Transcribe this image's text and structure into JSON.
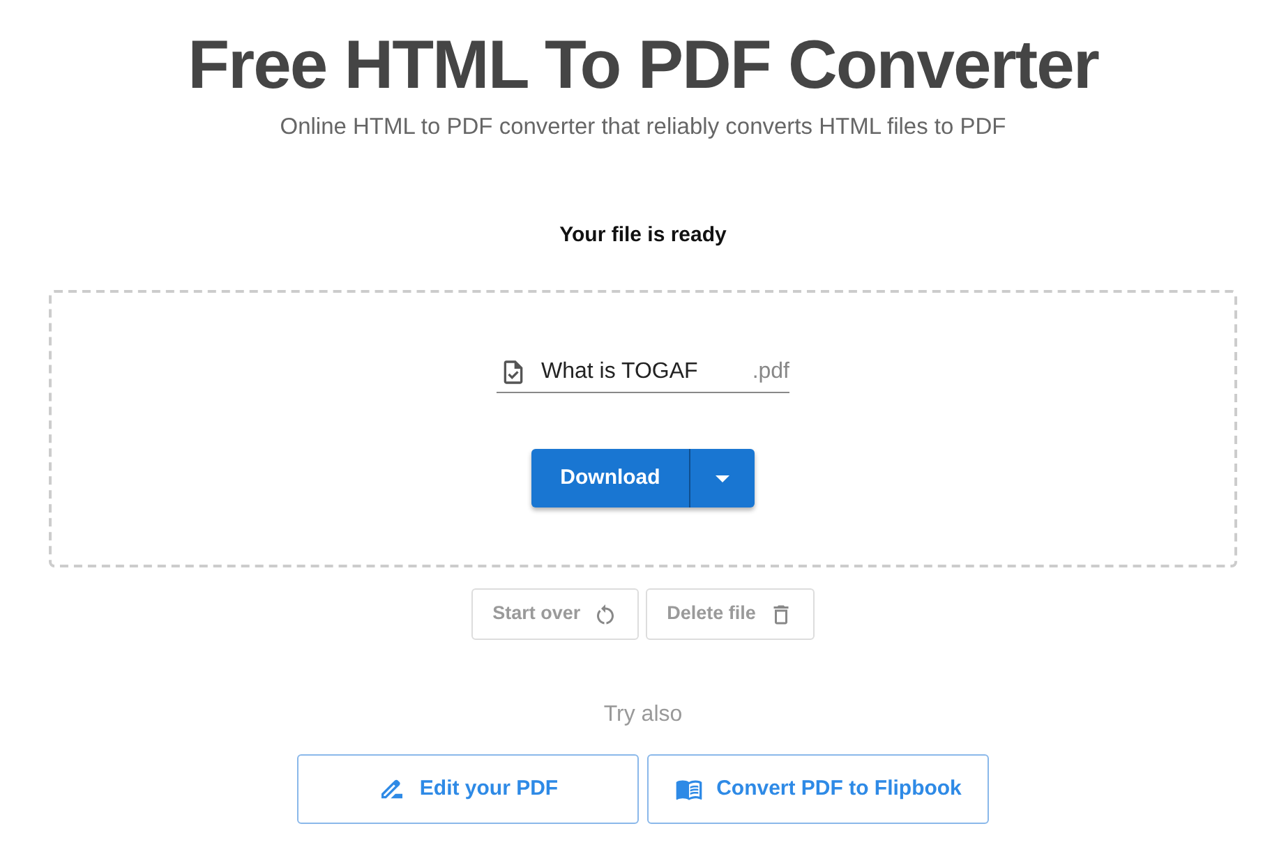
{
  "header": {
    "title": "Free HTML To PDF Converter",
    "subtitle": "Online HTML to PDF converter that reliably converts HTML files to PDF"
  },
  "result": {
    "heading": "Your file is ready",
    "file_name": "What is TOGAF",
    "extension": ".pdf",
    "download_button": "Download"
  },
  "actions": [
    {
      "label": "Start over",
      "kind": "restart"
    },
    {
      "label": "Delete file",
      "kind": "delete"
    }
  ],
  "try_also": {
    "heading": "Try also",
    "links": [
      {
        "label": "Edit your PDF",
        "kind": "edit"
      },
      {
        "label": "Convert PDF to Flipbook",
        "kind": "flipbook"
      }
    ]
  }
}
